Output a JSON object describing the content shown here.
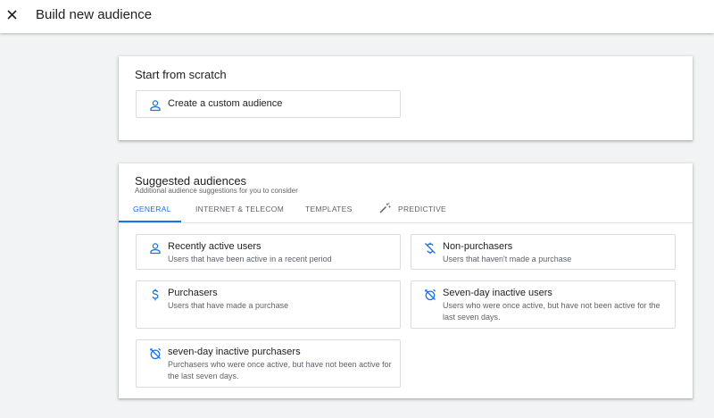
{
  "header": {
    "title": "Build new audience",
    "close_icon": "close-icon"
  },
  "scratch": {
    "title": "Start from scratch",
    "create": {
      "label": "Create a custom audience",
      "icon": "person-icon"
    }
  },
  "suggested": {
    "title": "Suggested audiences",
    "subtitle": "Additional audience suggestions for you to consider",
    "tabs": [
      {
        "label": "GENERAL",
        "active": true
      },
      {
        "label": "INTERNET & TELECOM",
        "active": false
      },
      {
        "label": "TEMPLATES",
        "active": false
      },
      {
        "label": "PREDICTIVE",
        "active": false,
        "icon": "magic-wand-icon"
      }
    ],
    "items": [
      {
        "title": "Recently active users",
        "desc": "Users that have been active in a recent period",
        "icon": "person-icon"
      },
      {
        "title": "Non-purchasers",
        "desc": "Users that haven't made a purchase",
        "icon": "no-dollar-icon"
      },
      {
        "title": "Purchasers",
        "desc": "Users that have made a purchase",
        "icon": "dollar-icon"
      },
      {
        "title": "Seven-day inactive users",
        "desc": "Users who were once active, but have not been active for the last seven days.",
        "icon": "alarm-off-icon"
      },
      {
        "title": "seven-day inactive purchasers",
        "desc": "Purchasers who were once active, but have not been active for the last seven days.",
        "icon": "alarm-off-icon"
      }
    ]
  },
  "colors": {
    "accent": "#1a73e8",
    "background": "#f1f3f4",
    "text": "#202124",
    "secondary_text": "#5f6368"
  }
}
